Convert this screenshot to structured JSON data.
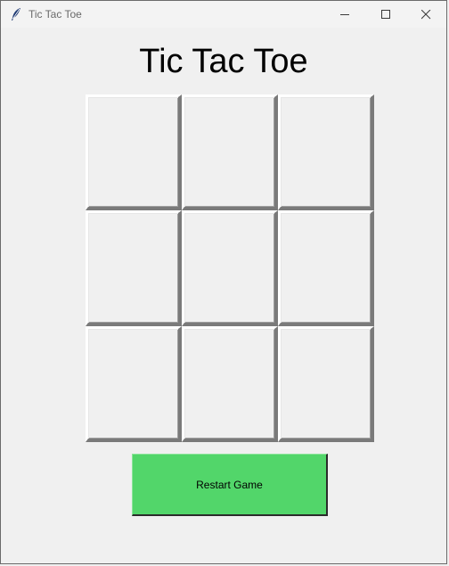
{
  "window": {
    "title": "Tic Tac Toe",
    "app_icon": "feather-icon",
    "controls": [
      "minimize-icon",
      "maximize-icon",
      "close-icon"
    ]
  },
  "game": {
    "heading": "Tic Tac Toe",
    "board": [
      [
        "",
        "",
        ""
      ],
      [
        "",
        "",
        ""
      ],
      [
        "",
        "",
        ""
      ]
    ]
  },
  "actions": {
    "restart_label": "Restart Game"
  },
  "colors": {
    "window_bg": "#f0f0f0",
    "restart_button_bg": "#52d66a"
  }
}
